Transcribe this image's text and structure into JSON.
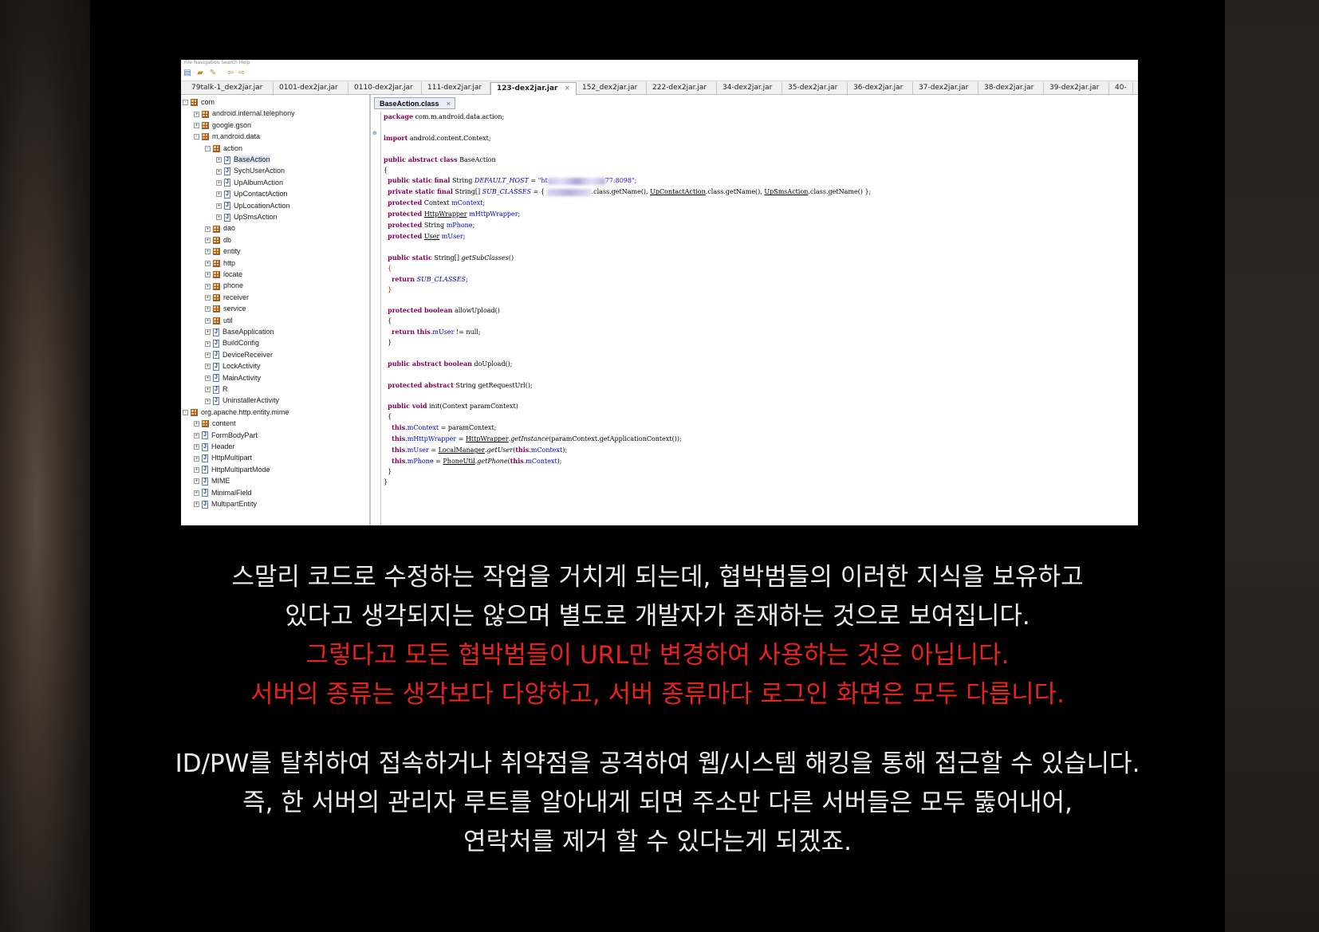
{
  "ide": {
    "menubar_text": "File  Navigation  Search  Help",
    "toolbar_icons": [
      "open-file-icon",
      "open-folder-icon",
      "link-icon",
      "back-arrow-icon",
      "forward-arrow-icon"
    ],
    "tabs": [
      {
        "label": "79talk-1_dex2jar.jar"
      },
      {
        "label": "0101-dex2jar.jar"
      },
      {
        "label": "0110-dex2jar.jar"
      },
      {
        "label": "111-dex2jar.jar"
      },
      {
        "label": "123-dex2jar.jar",
        "active": true
      },
      {
        "label": "152_dex2jar.jar"
      },
      {
        "label": "222-dex2jar.jar"
      },
      {
        "label": "34-dex2jar.jar"
      },
      {
        "label": "35-dex2jar.jar"
      },
      {
        "label": "36-dex2jar.jar"
      },
      {
        "label": "37-dex2jar.jar"
      },
      {
        "label": "38-dex2jar.jar"
      },
      {
        "label": "39-dex2jar.jar"
      },
      {
        "label": "40-"
      }
    ],
    "tree": [
      {
        "label": "com",
        "kind": "package",
        "toggle": "-"
      },
      {
        "label": "android.internal.telephony",
        "kind": "package",
        "toggle": "+"
      },
      {
        "label": "google.gson",
        "kind": "package",
        "toggle": "+"
      },
      {
        "label": "m.android.data",
        "kind": "package",
        "toggle": "-"
      },
      {
        "label": "action",
        "kind": "package",
        "toggle": "-"
      },
      {
        "label": "BaseAction",
        "kind": "class",
        "toggle": "+",
        "selected": true
      },
      {
        "label": "SychUserAction",
        "kind": "class",
        "toggle": "+"
      },
      {
        "label": "UpAlbumAction",
        "kind": "class",
        "toggle": "+"
      },
      {
        "label": "UpContactAction",
        "kind": "class",
        "toggle": "+"
      },
      {
        "label": "UpLocationAction",
        "kind": "class",
        "toggle": "+"
      },
      {
        "label": "UpSmsAction",
        "kind": "class",
        "toggle": "+"
      },
      {
        "label": "dao",
        "kind": "package",
        "toggle": "+"
      },
      {
        "label": "db",
        "kind": "package",
        "toggle": "+"
      },
      {
        "label": "entity",
        "kind": "package",
        "toggle": "+"
      },
      {
        "label": "http",
        "kind": "package",
        "toggle": "+"
      },
      {
        "label": "locate",
        "kind": "package",
        "toggle": "+"
      },
      {
        "label": "phone",
        "kind": "package",
        "toggle": "+"
      },
      {
        "label": "receiver",
        "kind": "package",
        "toggle": "+"
      },
      {
        "label": "service",
        "kind": "package",
        "toggle": "+"
      },
      {
        "label": "util",
        "kind": "package",
        "toggle": "+"
      },
      {
        "label": "BaseApplication",
        "kind": "class",
        "toggle": "+"
      },
      {
        "label": "BuildConfig",
        "kind": "class",
        "toggle": "+"
      },
      {
        "label": "DeviceReceiver",
        "kind": "class",
        "toggle": "+"
      },
      {
        "label": "LockActivity",
        "kind": "class",
        "toggle": "+"
      },
      {
        "label": "MainActivity",
        "kind": "class",
        "toggle": "+"
      },
      {
        "label": "R",
        "kind": "class",
        "toggle": "+"
      },
      {
        "label": "UninstallerActivity",
        "kind": "class",
        "toggle": "+"
      },
      {
        "label": "org.apache.http.entity.mime",
        "kind": "package",
        "toggle": "-"
      },
      {
        "label": "content",
        "kind": "package",
        "toggle": "+"
      },
      {
        "label": "FormBodyPart",
        "kind": "class",
        "toggle": "+"
      },
      {
        "label": "Header",
        "kind": "class",
        "toggle": "+"
      },
      {
        "label": "HttpMultipart",
        "kind": "class",
        "toggle": "+"
      },
      {
        "label": "HttpMultipartMode",
        "kind": "class",
        "toggle": "+"
      },
      {
        "label": "MIME",
        "kind": "class",
        "toggle": "+"
      },
      {
        "label": "MinimalField",
        "kind": "class",
        "toggle": "+"
      },
      {
        "label": "MultipartEntity",
        "kind": "class",
        "toggle": "+"
      }
    ],
    "editor_tab": "BaseAction.class",
    "code": {
      "package_kw": "package",
      "package_name": " com.m.android.data.action;",
      "import_kw": "import",
      "import_name": " android.content.Context;",
      "class_decl_kw": "public abstract class",
      "class_name": " BaseAction",
      "host_prefix": "public static final",
      "host_type": " String ",
      "host_field": "DEFAULT_HOST",
      "host_eq": " = ",
      "host_str_start": "\"ht",
      "host_str_end": "77:8098\";",
      "sub_prefix": "private static final",
      "sub_type": " String[] ",
      "sub_field": "SUB_CLASSES",
      "sub_eq": " = { ",
      "sub_tail_1": ".class.getName(), ",
      "sub_class_2": "UpContactAction",
      "sub_tail_2": ".class.getName(), ",
      "sub_class_3": "UpSmsAction",
      "sub_tail_3": ".class.getName() };",
      "l_ctx_kw": "protected",
      "l_ctx_rest": " Context ",
      "l_ctx_field": "mContext",
      "l_http_kw": "protected",
      "l_http_type": "HttpWrapper",
      "l_http_field": "mHttpWrapper",
      "l_phone_kw": "protected",
      "l_phone_rest": " String ",
      "l_phone_field": "mPhone",
      "l_user_kw": "protected",
      "l_user_type": "User",
      "l_user_field": "mUser",
      "getsub_kw": "public static",
      "getsub_rest": " String[] ",
      "getsub_name": "getSubClasses",
      "getsub_parens": "()",
      "return_kw": "return",
      "return_val": "SUB_CLASSES",
      "allow_kw": "protected boolean",
      "allow_rest": " allowUpload()",
      "allow_ret_kw": "return this",
      "allow_ret_field": ".mUser",
      "allow_ret_rest": " != null;",
      "doup_kw": "public abstract boolean",
      "doup_rest": " doUpload();",
      "getreq_kw": "protected abstract",
      "getreq_rest": " String getRequestUrl();",
      "init_kw": "public void",
      "init_rest": " init(Context paramContext)",
      "i1_this": "this",
      "i1_field": ".mContext",
      "i1_rest": " = paramContext;",
      "i2_this": "this",
      "i2_field": ".mHttpWrapper",
      "i2_eq": " = ",
      "i2_cls": "HttpWrapper",
      "i2_mid": ".getInstance",
      "i2_rest": "(paramContext.getApplicationContext());",
      "i3_this": "this",
      "i3_field": ".mUser",
      "i3_eq": " = ",
      "i3_cls": "LocalManager",
      "i3_mid": ".getUser",
      "i3_rest_a": "(",
      "i3_this2": "this",
      "i3_field2": ".mContext",
      "i3_rest_b": ");",
      "i4_this": "this",
      "i4_field": ".mPhone",
      "i4_eq": " = ",
      "i4_cls": "PhoneUtil",
      "i4_mid": ".getPhone",
      "i4_rest_a": "(",
      "i4_this2": "this",
      "i4_field2": ".mContext",
      "i4_rest_b": ");"
    }
  },
  "captions": {
    "line1": "스말리 코드로 수정하는 작업을 거치게 되는데, 협박범들의 이러한 지식을 보유하고",
    "line2": "있다고 생각되지는 않으며 별도로 개발자가 존재하는 것으로 보여집니다.",
    "line3": "그렇다고 모든 협박범들이 URL만 변경하여 사용하는 것은 아닙니다.",
    "line4": "서버의 종류는 생각보다 다양하고, 서버 종류마다 로그인 화면은 모두 다릅니다.",
    "line5": "ID/PW를 탈취하여 접속하거나 취약점을 공격하여 웹/시스템 해킹을 통해 접근할 수 있습니다.",
    "line6": "즉, 한 서버의 관리자 루트를 알아내게 되면 주소만 다른 서버들은 모두 뚫어내어,",
    "line7": "연락처를 제거 할 수 있다는게 되겠죠."
  },
  "colors": {
    "caption_white": "#ececec",
    "caption_red": "#e8231d",
    "background": "#000000"
  }
}
